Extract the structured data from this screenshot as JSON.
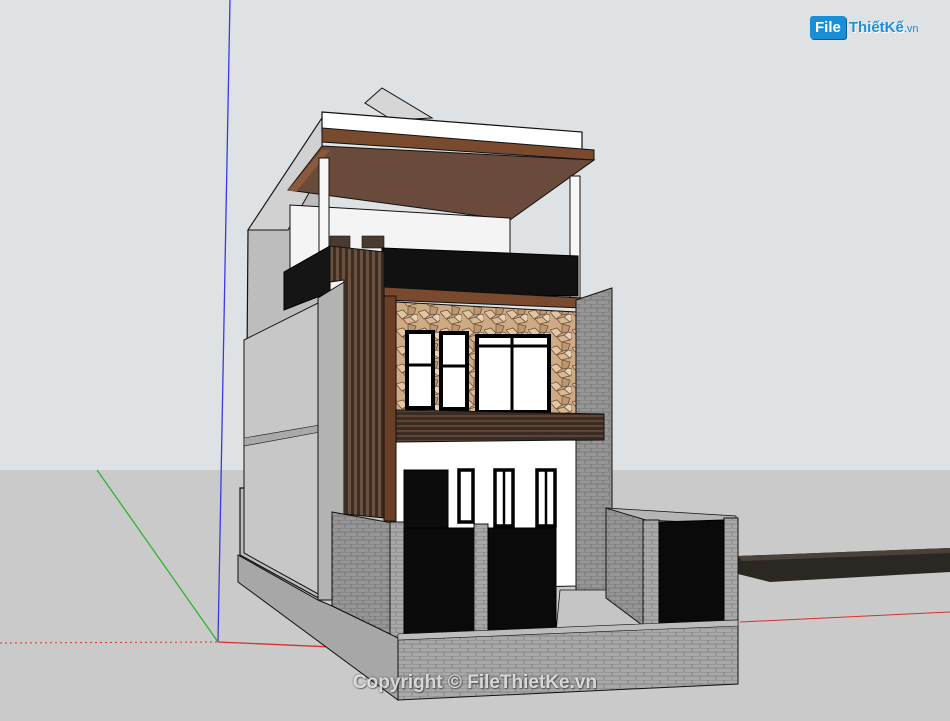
{
  "logo": {
    "badge": "File",
    "name": "ThiếtKế",
    "tld": ".vn",
    "color": "#1a8fd8"
  },
  "watermark": {
    "text": "Copyright © FileThietKe.vn"
  },
  "scene": {
    "sky_color": "#dfe2e4",
    "ground_color": "#cacaca",
    "axis_colors": {
      "blue": "#3a3ae0",
      "red": "#d93030",
      "green": "#2fb32f"
    }
  }
}
